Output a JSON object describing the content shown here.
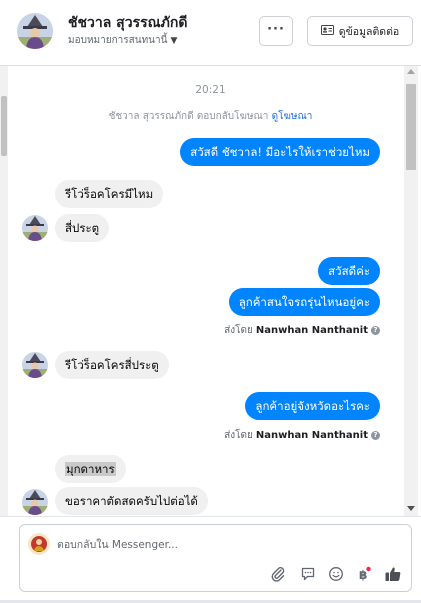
{
  "header": {
    "contact_name": "ชัชวาล สุวรรณภักดี",
    "assign_label": "มอบหมายการสนทนานี้",
    "more_label": "···",
    "info_button_label": "ดูข้อมูลติดต่อ"
  },
  "conversation": {
    "timestamp": "20:21",
    "ad_reply_note": "ชัชวาล สุวรรณภักดี ตอบกลับโฆษณา",
    "ad_reply_link": "ดูโฆษณา",
    "messages": [
      {
        "dir": "out",
        "text": "สวัสดี ชัชวาล! มีอะไรให้เราช่วยไหม"
      },
      {
        "dir": "in",
        "text": "รีโว่ร็อคโครมีไหม"
      },
      {
        "dir": "in",
        "text": "สี่ประตู"
      },
      {
        "dir": "out",
        "text": "สวัสดีค่ะ"
      },
      {
        "dir": "out",
        "text": "ลูกค้าสนใจรถรุ่นไหนอยู่คะ"
      },
      {
        "dir": "in",
        "text": "รีโว่ร็อคโครสี่ประตู"
      },
      {
        "dir": "out",
        "text": "ลูกค้าอยู่จังหวัดอะไรคะ"
      },
      {
        "dir": "in",
        "text": "มุกดาหาร"
      },
      {
        "dir": "in",
        "text": "ขอราคาตัดสดครับไปต่อได้"
      }
    ],
    "sent_by_prefix": "ส่งโดย",
    "sent_by_name": "Nanwhan Nanthanit"
  },
  "composer": {
    "placeholder": "ตอบกลับใน Messenger...",
    "tools": [
      "paperclip-icon",
      "saved-reply-icon",
      "emoji-icon",
      "baht-icon",
      "thumbs-up-icon"
    ]
  },
  "colors": {
    "outgoing_bubble": "#0084ff",
    "incoming_bubble": "#f0f0f0",
    "link": "#216fdb"
  }
}
